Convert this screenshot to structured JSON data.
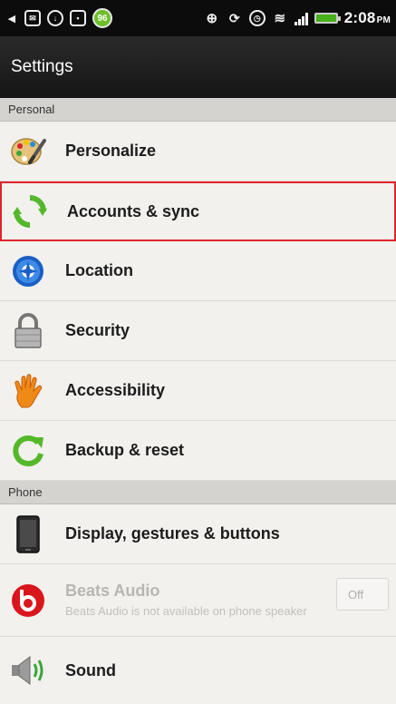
{
  "status_bar": {
    "battery_badge": "96",
    "time": "2:08",
    "ampm": "PM"
  },
  "header": {
    "title": "Settings"
  },
  "sections": {
    "personal": "Personal",
    "phone": "Phone"
  },
  "items": {
    "personalize": "Personalize",
    "accounts_sync": "Accounts & sync",
    "location": "Location",
    "security": "Security",
    "accessibility": "Accessibility",
    "backup_reset": "Backup & reset",
    "display": "Display, gestures & buttons",
    "beats": "Beats Audio",
    "beats_sub": "Beats Audio is not available on phone speaker",
    "beats_toggle": "Off",
    "sound": "Sound"
  },
  "colors": {
    "accent_selected": "#e0242d",
    "sync_green": "#55b82a",
    "location_blue": "#1a5fc4",
    "beats_red": "#d9161c"
  }
}
